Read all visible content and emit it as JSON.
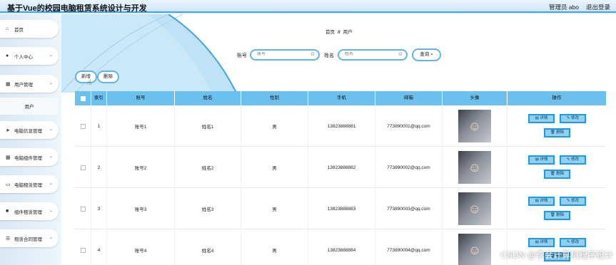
{
  "header": {
    "title": "基于Vue的校园电脑租赁系统设计与开发",
    "admin_label": "管理员 abo",
    "logout_label": "退出登录"
  },
  "sidebar": {
    "items": [
      {
        "label": "首页",
        "icon": "home-icon"
      },
      {
        "label": "个人中心",
        "icon": "user-icon"
      },
      {
        "label": "用户管理",
        "icon": "grid-icon"
      },
      {
        "label": "电脑信息管理",
        "icon": "send-icon"
      },
      {
        "label": "电脑组件管理",
        "icon": "grid-icon"
      },
      {
        "label": "电脑租赁管理",
        "icon": "laptop-icon"
      },
      {
        "label": "组件租赁管理",
        "icon": "box-icon"
      },
      {
        "label": "租赁合同管理",
        "icon": "list-icon"
      }
    ],
    "sub_item": "用户"
  },
  "breadcrumb": {
    "home": "首页",
    "separator": "//",
    "current": "用户"
  },
  "search": {
    "account_label": "账号",
    "account_placeholder": "账号",
    "name_label": "姓名",
    "name_placeholder": "姓名",
    "query_label": "查询"
  },
  "toolbar": {
    "add_label": "新增",
    "delete_label": "删除"
  },
  "table": {
    "headers": [
      "索引",
      "账号",
      "姓名",
      "性别",
      "手机",
      "邮箱",
      "头像",
      "操作"
    ],
    "rows": [
      {
        "index": "1",
        "account": "账号1",
        "name": "姓名1",
        "gender": "男",
        "phone": "13823888881",
        "email": "773890001@qq.com"
      },
      {
        "index": "2",
        "account": "账号2",
        "name": "姓名2",
        "gender": "男",
        "phone": "13823888882",
        "email": "773890002@qq.com"
      },
      {
        "index": "3",
        "account": "账号3",
        "name": "姓名3",
        "gender": "男",
        "phone": "13823888883",
        "email": "773890003@qq.com"
      },
      {
        "index": "4",
        "account": "账号4",
        "name": "姓名4",
        "gender": "男",
        "phone": "13823888884",
        "email": "773890004@qq.com"
      }
    ],
    "actions": {
      "detail": "详情",
      "edit": "修改",
      "delete": "删除"
    }
  },
  "watermark": "CSDN @李会计算机程序设计"
}
